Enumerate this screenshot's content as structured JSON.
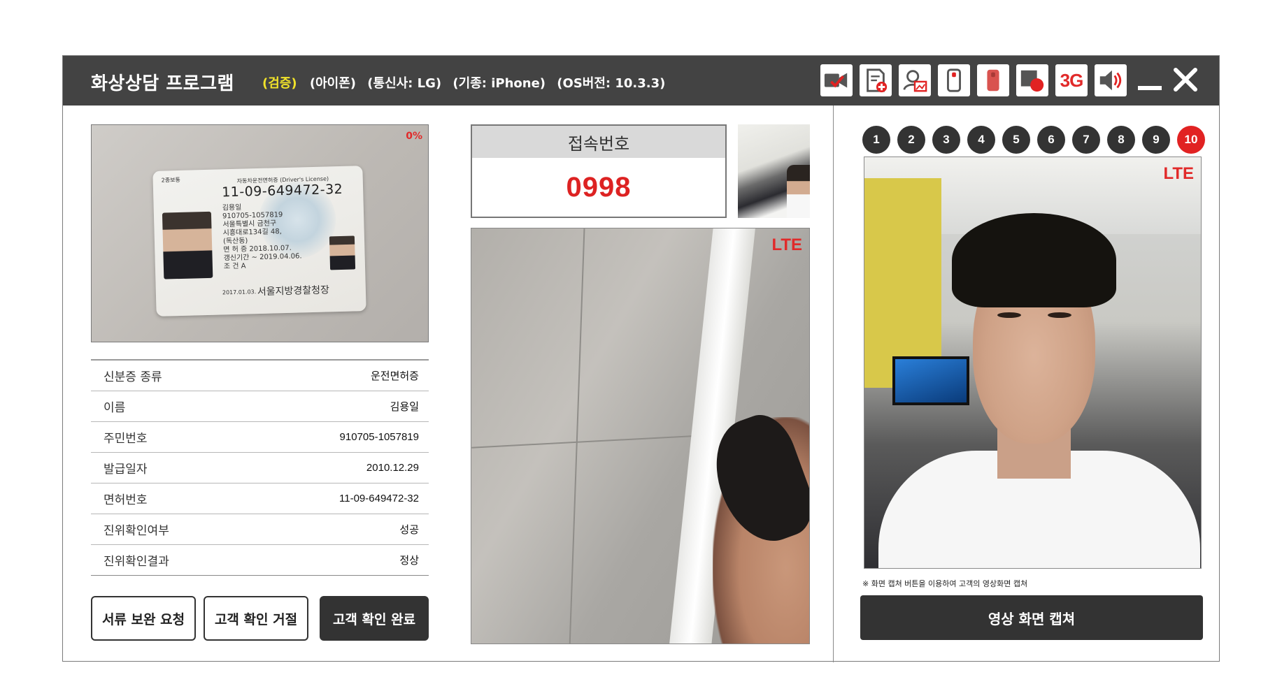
{
  "window": {
    "app_title": "화상상담 프로그램",
    "verify_label": "(검증)",
    "device_label": "(아이폰)",
    "carrier_label": "(통신사: LG)",
    "model_label": "(기종: iPhone)",
    "os_label": "(OS버전: 10.3.3)",
    "toolbar_3g": "3G"
  },
  "id_card": {
    "match_percent": "0%",
    "license_type": "2종보통",
    "license_title": "자동차운전면허증 (Driver's License)",
    "license_number": "11-09-649472-32",
    "license_lines": [
      "김용일",
      "910705-1057819",
      "서울특별시 금천구",
      "시흥대로134길 48,",
      "(독산동)",
      "면 허 증 2018.10.07.",
      "갱신기간 ~ 2019.04.06.",
      "조 건 A"
    ],
    "issue_date_text": "2017.01.03.",
    "police_text": "서울지방경찰청장"
  },
  "info": {
    "rows": [
      {
        "label": "신분증 종류",
        "value": "운전면허증"
      },
      {
        "label": "이름",
        "value": "김용일"
      },
      {
        "label": "주민번호",
        "value": "910705-1057819"
      },
      {
        "label": "발급일자",
        "value": "2010.12.29"
      },
      {
        "label": "면허번호",
        "value": "11-09-649472-32"
      },
      {
        "label": "진위확인여부",
        "value": "성공"
      },
      {
        "label": "진위확인결과",
        "value": "정상"
      }
    ]
  },
  "actions": {
    "request_docs": "서류 보완 요청",
    "reject": "고객 확인 거절",
    "complete": "고객 확인 완료"
  },
  "connection": {
    "header": "접속번호",
    "number": "0998"
  },
  "network": {
    "mid_label": "LTE",
    "right_label": "LTE"
  },
  "slots": {
    "numbers": [
      "1",
      "2",
      "3",
      "4",
      "5",
      "6",
      "7",
      "8",
      "9",
      "10"
    ],
    "active": "10"
  },
  "capture": {
    "note": "※ 화면 캡쳐 버튼을 이용하여 고객의 영상화면 캡쳐",
    "button": "영상 화면 캡쳐"
  },
  "colors": {
    "titlebar": "#434343",
    "accent_red": "#e12222",
    "verify_yellow": "#f1e32a",
    "dark_button": "#333333"
  },
  "toolbar_icons": [
    "video-check-icon",
    "document-add-icon",
    "agent-image-icon",
    "phone-outline-icon",
    "phone-filled-icon",
    "record-icon",
    "3g-icon",
    "speaker-icon"
  ]
}
